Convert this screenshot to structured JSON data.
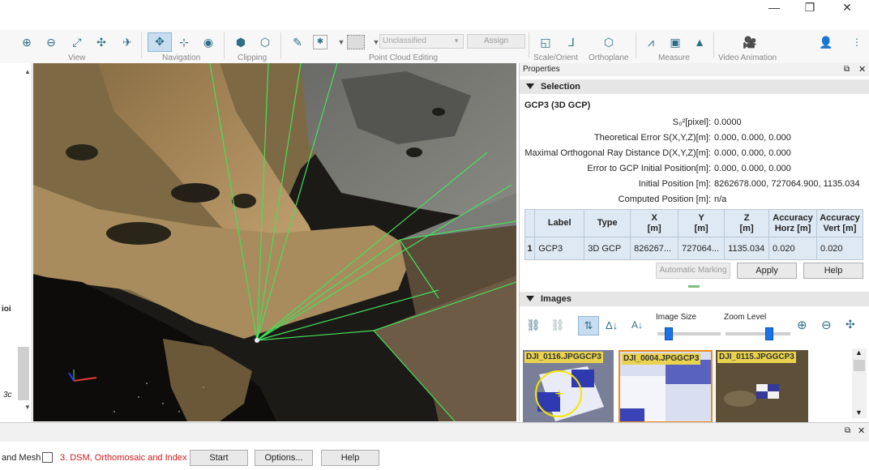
{
  "window": {
    "minimize": "—",
    "maximize": "❐",
    "close": "✕"
  },
  "toolbar": {
    "groups": {
      "view": "View",
      "navigation": "Navigation",
      "clipping": "Clipping",
      "point_cloud_editing": "Point Cloud Editing",
      "scale_orient": "Scale/Orient",
      "orthoplane": "Orthoplane",
      "measure": "Measure",
      "video_animation": "Video Animation"
    },
    "classification_value": "Unclassified",
    "assign_label": "Assign"
  },
  "left_strip": {
    "text1": "ioi",
    "text2": "3c"
  },
  "properties": {
    "title": "Properties",
    "selection_header": "Selection",
    "item_title": "GCP3 (3D GCP)",
    "rows": [
      {
        "key": "S₀²[pixel]:",
        "value": "0.0000"
      },
      {
        "key": "Theoretical Error S(X,Y,Z)[m]:",
        "value": "0.000, 0.000, 0.000"
      },
      {
        "key": "Maximal Orthogonal Ray Distance D(X,Y,Z)[m]:",
        "value": "0.000, 0.000, 0.000"
      },
      {
        "key": "Error to GCP Initial Position[m]:",
        "value": "0.000, 0.000, 0.000"
      },
      {
        "key": "Initial Position [m]:",
        "value": "8262678.000, 727064.900, 1135.034"
      },
      {
        "key": "Computed Position [m]:",
        "value": "n/a"
      }
    ],
    "table": {
      "headers": [
        "Label",
        "Type",
        "X\n[m]",
        "Y\n[m]",
        "Z\n[m]",
        "Accuracy\nHorz [m]",
        "Accuracy\nVert [m]"
      ],
      "rows": [
        {
          "num": "1",
          "label": "GCP3",
          "type": "3D GCP",
          "x": "826267...",
          "y": "727064...",
          "z": "1135.034",
          "acc_h": "0.020",
          "acc_v": "0.020"
        }
      ]
    },
    "buttons": {
      "automatic_marking": "Automatic Marking",
      "apply": "Apply",
      "help": "Help"
    },
    "images_header": "Images",
    "image_size_label": "Image Size",
    "zoom_level_label": "Zoom Level",
    "image_size_level": 0.13,
    "zoom_level": 0.7,
    "tiles": [
      {
        "name": "DJI_0116.JPG",
        "gcp": "GCP3"
      },
      {
        "name": "DJI_0004.JPG",
        "gcp": "GCP3"
      },
      {
        "name": "DJI_0115.JPG",
        "gcp": "GCP3"
      }
    ]
  },
  "bottom": {
    "mesh_label": "and Mesh",
    "step3_label": "3. DSM, Orthomosaic and Index",
    "start": "Start",
    "options": "Options...",
    "help": "Help"
  },
  "colors": {
    "accent": "#2f6f86",
    "step3": "#d11a1a",
    "tile_selected": "#f08a1c",
    "ray": "#44e05a"
  }
}
